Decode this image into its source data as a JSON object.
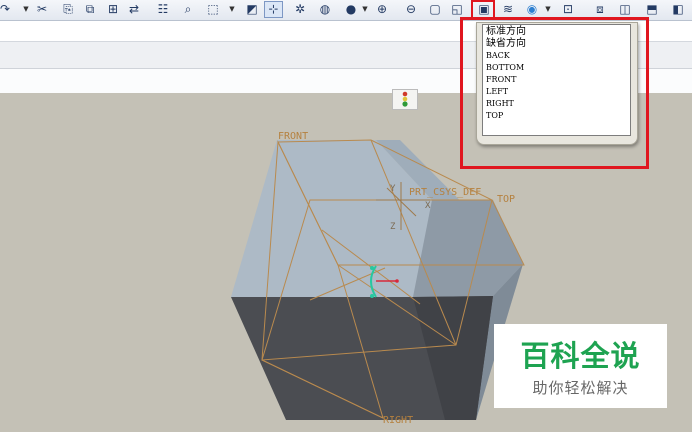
{
  "toolbar": {
    "buttons": [
      {
        "name": "redo-icon",
        "glyph": "↷"
      },
      {
        "name": "cut-icon",
        "glyph": "✂"
      },
      {
        "name": "copy-icon",
        "glyph": "⎘"
      },
      {
        "name": "paste-icon",
        "glyph": "⧉"
      },
      {
        "name": "paste-special-icon",
        "glyph": "⊞"
      },
      {
        "name": "regenerate-icon",
        "glyph": "⇄"
      },
      {
        "name": "model-tree-icon",
        "glyph": "☷"
      },
      {
        "name": "find-icon",
        "glyph": "⌕"
      },
      {
        "name": "select-box-icon",
        "glyph": "⬚"
      },
      {
        "name": "sketch-icon",
        "glyph": "◩"
      },
      {
        "name": "datum-display-icon",
        "glyph": "⊹"
      },
      {
        "name": "spin-center-icon",
        "glyph": "✲"
      },
      {
        "name": "appearance-icon",
        "glyph": "◍"
      },
      {
        "name": "shading-icon",
        "glyph": "●"
      },
      {
        "name": "zoom-in-icon",
        "glyph": "⊕"
      },
      {
        "name": "zoom-out-icon",
        "glyph": "⊖"
      },
      {
        "name": "refit-icon",
        "glyph": "▢"
      },
      {
        "name": "reorient-icon",
        "glyph": "◱"
      },
      {
        "name": "saved-views-icon",
        "glyph": "▣"
      },
      {
        "name": "layers-icon",
        "glyph": "≋"
      },
      {
        "name": "display-style-icon",
        "glyph": "◉"
      },
      {
        "name": "model-display-icon",
        "glyph": "⊡"
      },
      {
        "name": "wireframe-icon",
        "glyph": "⧈"
      },
      {
        "name": "hidden-line-icon",
        "glyph": "◫"
      },
      {
        "name": "no-hidden-icon",
        "glyph": "⬒"
      },
      {
        "name": "shaded-icon",
        "glyph": "◧"
      }
    ]
  },
  "view_dropdown": {
    "items": [
      "标准方向",
      "缺省方向",
      "BACK",
      "BOTTOM",
      "FRONT",
      "LEFT",
      "RIGHT",
      "TOP"
    ]
  },
  "model": {
    "labels": {
      "front": "FRONT",
      "top": "TOP",
      "right": "RIGHT",
      "csys": "PRT_CSYS_DEF",
      "x": "X",
      "y": "Y",
      "z": "Z"
    }
  },
  "watermark": {
    "title": "百科全说",
    "subtitle": "助你轻松解决"
  },
  "colors": {
    "background": "#c4c1b6",
    "cube_light": "#aebbc7",
    "cube_dark": "#4b4d52",
    "datum": "#b98a4e",
    "highlight": "#e0161f",
    "watermark_green": "#1ea351"
  }
}
